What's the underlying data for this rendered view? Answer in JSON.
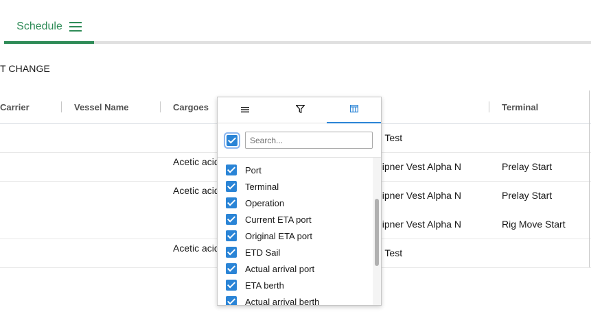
{
  "tabs": {
    "schedule_label": "Schedule",
    "menu_icon": "hamburger-icon",
    "accent": "#2e8b57"
  },
  "section_title": "T CHANGE",
  "grid": {
    "columns": [
      "Carrier",
      "Vessel Name",
      "Cargoes",
      "Terminal"
    ],
    "rows": [
      {
        "cargo": "",
        "location": "d Test",
        "terminal": ""
      },
      {
        "cargo": "Acetic acid",
        "location": "eipner Vest Alpha N",
        "terminal": "Prelay Start"
      },
      {
        "cargo": "Acetic acid",
        "location": "eipner Vest Alpha N",
        "terminal": "Prelay Start"
      },
      {
        "cargo": "",
        "location": "eipner Vest Alpha N",
        "terminal": "Rig Move Start"
      },
      {
        "cargo": "Acetic acid",
        "location": "d Test",
        "terminal": ""
      }
    ]
  },
  "column_menu": {
    "tab_icons": [
      "menu-lines-icon",
      "filter-icon",
      "columns-icon"
    ],
    "active_tab": "columns",
    "search_placeholder": "Search...",
    "select_all_checked": true,
    "items": [
      {
        "label": "Port",
        "checked": true
      },
      {
        "label": "Terminal",
        "checked": true
      },
      {
        "label": "Operation",
        "checked": true
      },
      {
        "label": "Current ETA port",
        "checked": true
      },
      {
        "label": "Original ETA port",
        "checked": true
      },
      {
        "label": "ETD Sail",
        "checked": true
      },
      {
        "label": "Actual arrival port",
        "checked": true
      },
      {
        "label": "ETA berth",
        "checked": true
      },
      {
        "label": "Actual arrival berth",
        "checked": true
      }
    ],
    "accent": "#2a84d6"
  }
}
